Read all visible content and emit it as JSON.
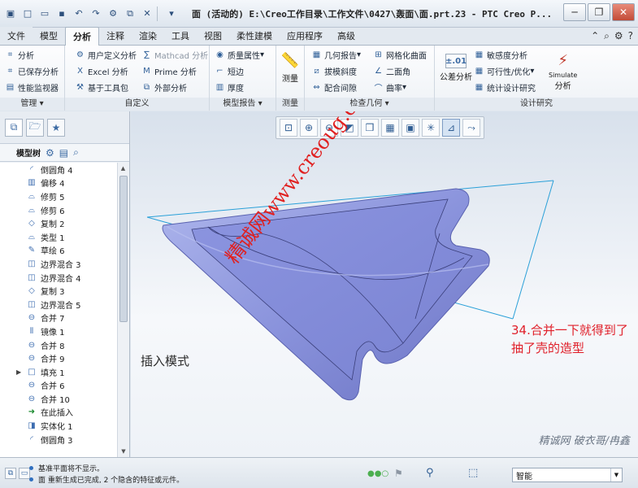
{
  "titlebar": {
    "title": "面 (活动的) E:\\Creo工作目录\\工作文件\\0427\\轰面\\面.prt.23 - PTC Creo P..."
  },
  "tabs": [
    "文件",
    "模型",
    "分析",
    "注释",
    "渲染",
    "工具",
    "视图",
    "柔性建模",
    "应用程序",
    "高级"
  ],
  "active_tab": "分析",
  "ribbon": {
    "manage": {
      "label": "管理",
      "items": [
        "分析",
        "已保存分析",
        "性能监视器"
      ]
    },
    "custom": {
      "label": "自定义",
      "items": [
        "用户定义分析",
        "Excel 分析",
        "基于工具包",
        "Mathcad 分析",
        "Prime 分析",
        "外部分析"
      ]
    },
    "model_report": {
      "label": "模型报告",
      "items": [
        "质量属性",
        "短边",
        "厚度"
      ]
    },
    "measure": {
      "label": "测量",
      "button": "测量"
    },
    "inspect": {
      "label": "检查几何",
      "items": [
        "几何报告",
        "网格化曲面",
        "拔模斜度",
        "二面角",
        "配合间隙",
        "曲率"
      ]
    },
    "design": {
      "label": "设计研究",
      "tolerance": "公差分析",
      "tolerance_value": "±.01",
      "items": [
        "敏感度分析",
        "可行性/优化",
        "统计设计研究"
      ],
      "simulate": "Simulate",
      "simulate_sub": "分析"
    }
  },
  "model_tree": {
    "header": "模型树",
    "items": [
      {
        "label": "倒圆角 4",
        "icon": "round-icon"
      },
      {
        "label": "偏移 4",
        "icon": "offset-icon"
      },
      {
        "label": "修剪 5",
        "icon": "trim-icon"
      },
      {
        "label": "修剪 6",
        "icon": "trim-icon"
      },
      {
        "label": "复制 2",
        "icon": "copy-icon"
      },
      {
        "label": "类型 1",
        "icon": "type-icon"
      },
      {
        "label": "草绘 6",
        "icon": "sketch-icon"
      },
      {
        "label": "边界混合 3",
        "icon": "boundary-icon"
      },
      {
        "label": "边界混合 4",
        "icon": "boundary-icon"
      },
      {
        "label": "复制 3",
        "icon": "copy-icon"
      },
      {
        "label": "边界混合 5",
        "icon": "boundary-icon"
      },
      {
        "label": "合并 7",
        "icon": "merge-icon"
      },
      {
        "label": "镜像 1",
        "icon": "mirror-icon"
      },
      {
        "label": "合并 8",
        "icon": "merge-icon"
      },
      {
        "label": "合并 9",
        "icon": "merge-icon"
      },
      {
        "label": "填充 1",
        "icon": "fill-icon"
      },
      {
        "label": "合并 6",
        "icon": "merge-icon"
      },
      {
        "label": "合并 10",
        "icon": "merge-icon"
      },
      {
        "label": "在此插入",
        "icon": "insert-arrow-icon"
      },
      {
        "label": "实体化 1",
        "icon": "solidify-icon"
      },
      {
        "label": "倒圆角 3",
        "icon": "round-icon"
      }
    ]
  },
  "graphics": {
    "insert_mode": "插入模式",
    "watermark_url": "精诚网www.creoug.com",
    "annotation": "34.合并一下就得到了抽了壳的造型",
    "signature": "精诚网 破衣哥/冉鑫"
  },
  "status": {
    "messages": [
      "基准平面将不显示。",
      "面 重新生成已完成, 2 个隐含的特征或元件。"
    ],
    "selection_filter": "智能"
  }
}
